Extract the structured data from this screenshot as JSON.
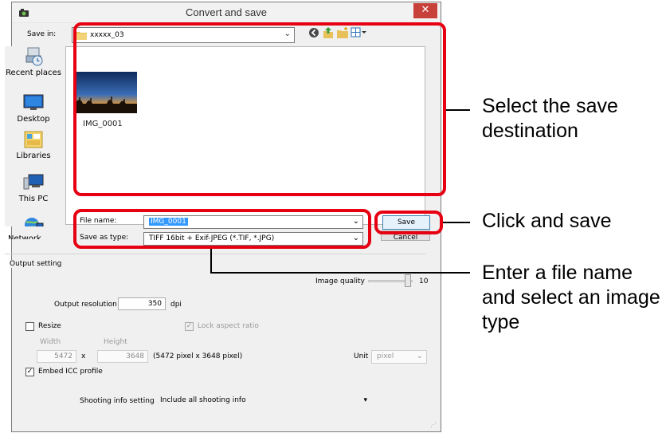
{
  "window": {
    "title": "Convert and save",
    "close_glyph": "✕"
  },
  "save_in": {
    "label": "Save in:",
    "folder": "xxxxx_03",
    "toolbar_icons": [
      "back-icon",
      "up-folder-icon",
      "new-folder-icon",
      "view-menu-icon"
    ]
  },
  "places": [
    {
      "label": "Recent places",
      "icon": "recent-places-icon"
    },
    {
      "label": "Desktop",
      "icon": "desktop-icon"
    },
    {
      "label": "Libraries",
      "icon": "libraries-icon"
    },
    {
      "label": "This PC",
      "icon": "this-pc-icon"
    },
    {
      "label": "Network",
      "icon": "network-icon"
    }
  ],
  "files": [
    {
      "name": "IMG_0001"
    }
  ],
  "file_name": {
    "label": "File name:",
    "value": "IMG_0001"
  },
  "save_as_type": {
    "label": "Save as type:",
    "value": "TIFF 16bit + Exif-JPEG (*.TIF, *.JPG)"
  },
  "buttons": {
    "save": "Save",
    "cancel": "Cancel"
  },
  "output": {
    "group_title": "Output setting",
    "image_quality_label": "Image quality",
    "image_quality_value": "10",
    "resolution_label": "Output resolution",
    "resolution_value": "350",
    "resolution_unit": "dpi",
    "resize_label": "Resize",
    "resize_checked": false,
    "lock_aspect_label": "Lock aspect ratio",
    "lock_aspect_checked": true,
    "width_label": "Width",
    "height_label": "Height",
    "width_value": "5472",
    "height_value": "3648",
    "times": "x",
    "size_note": "(5472 pixel x 3648 pixel)",
    "unit_label": "Unit",
    "unit_value": "pixel",
    "embed_icc_label": "Embed ICC profile",
    "embed_icc_checked": true,
    "shooting_info_label": "Shooting info setting",
    "shooting_info_value": "Include all shooting info"
  },
  "annotations": {
    "save_destination": "Select the save destination",
    "click_save": "Click and save",
    "file_name_type": "Enter a file name and select an image type"
  },
  "colors": {
    "callout_red": "#e60012",
    "close_red": "#c7403a",
    "selection_blue": "#3399ff"
  }
}
